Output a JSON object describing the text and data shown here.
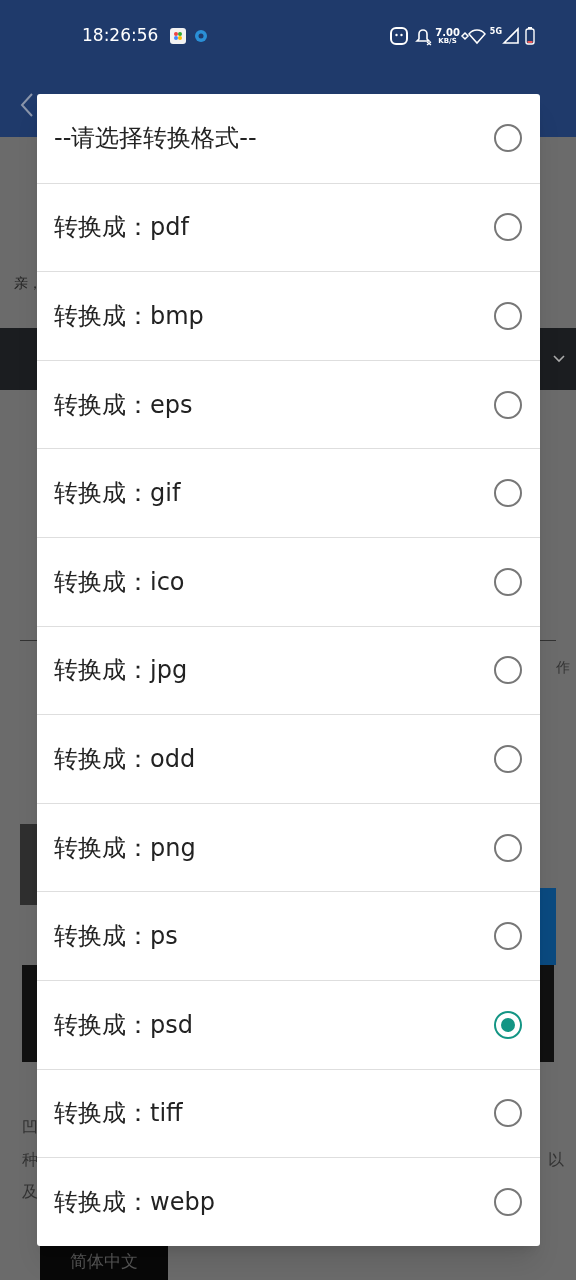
{
  "status_bar": {
    "time": "18:26:56",
    "speed": "7.00",
    "speed_unit": "KB/S",
    "network": "5G"
  },
  "background": {
    "notice": "亲，",
    "right_fragment": "作",
    "left_fragments": [
      "凹",
      "种",
      "及"
    ],
    "right_fragment_2": "以",
    "language": "简体中文"
  },
  "dialog": {
    "options": [
      {
        "label": "--请选择转换格式--",
        "selected": false
      },
      {
        "label": "转换成：pdf",
        "selected": false
      },
      {
        "label": "转换成：bmp",
        "selected": false
      },
      {
        "label": "转换成：eps",
        "selected": false
      },
      {
        "label": "转换成：gif",
        "selected": false
      },
      {
        "label": "转换成：ico",
        "selected": false
      },
      {
        "label": "转换成：jpg",
        "selected": false
      },
      {
        "label": "转换成：odd",
        "selected": false
      },
      {
        "label": "转换成：png",
        "selected": false
      },
      {
        "label": "转换成：ps",
        "selected": false
      },
      {
        "label": "转换成：psd",
        "selected": true
      },
      {
        "label": "转换成：tiff",
        "selected": false
      },
      {
        "label": "转换成：webp",
        "selected": false
      }
    ]
  }
}
